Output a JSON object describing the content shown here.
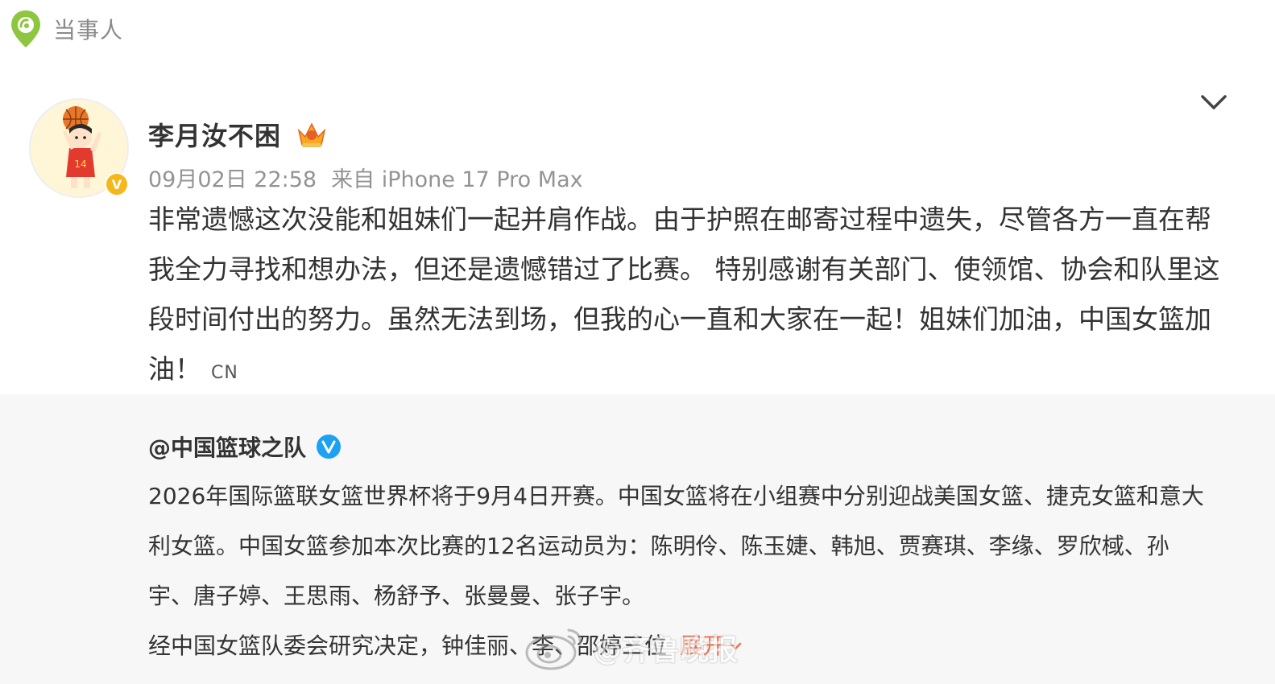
{
  "header": {
    "label": "当事人",
    "pin_icon": "location-pin-icon"
  },
  "post": {
    "author": {
      "name": "李月汝不困",
      "avatar": "basketball-player-cartoon-avatar",
      "avatar_caption": "李月汝",
      "verified_badge": "V",
      "crown_icon": "member-crown-icon"
    },
    "time": "09月02日 22:58",
    "source": "来自 iPhone 17 Pro Max",
    "text": "非常遗憾这次没能和姐妹们一起并肩作战。由于护照在邮寄过程中遗失，尽管各方一直在帮我全力寻找和想办法，但还是遗憾错过了比赛。 特别感谢有关部门、使领馆、协会和队里这段时间付出的努力。虽然无法到场，但我的心一直和大家在一起！姐妹们加油，中国女篮加油！",
    "lang_tag": "CN",
    "collapse_icon": "chevron-down-icon"
  },
  "repost": {
    "author": "@中国篮球之队",
    "verified_icon": "blue-verified-icon",
    "text": "2026年国际篮联女篮世界杯将于9月4日开赛。中国女篮将在小组赛中分别迎战美国女篮、捷克女篮和意大利女篮。中国女篮参加本次比赛的12名运动员为：陈明伶、陈玉婕、韩旭、贾赛琪、李缘、罗欣棫、孙宇、唐子婷、王思雨、杨舒予、张曼曼、张子宇。",
    "last_line": "经中国女篮队委会研究决定，钟佳丽、李",
    "last_line_tail": "、邵婷三位",
    "expand_label": "展开"
  },
  "watermark": {
    "text": "@齐鲁晚报"
  },
  "colors": {
    "accent_orange": "#eb7350",
    "verified_gold": "#f5b81c",
    "verified_blue": "#1da1f2",
    "pin_green": "#8ec63f",
    "meta_gray": "#939393"
  }
}
